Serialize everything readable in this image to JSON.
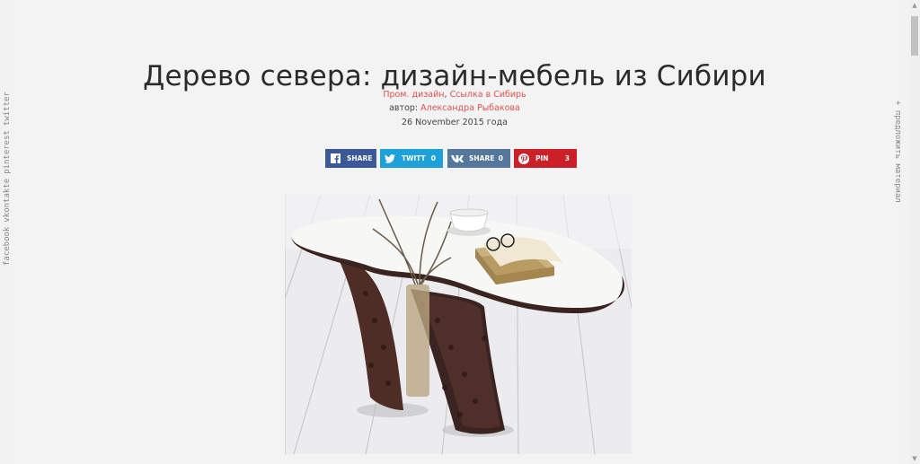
{
  "article": {
    "title": "Дерево севера: дизайн-мебель из Сибири",
    "categories": [
      "Пром. дизайн",
      "Ссылка в Сибирь"
    ],
    "category_separator": ", ",
    "author_prefix": "автор: ",
    "author_name": "Александра Рыбакова",
    "date": "26 November 2015 года"
  },
  "share": {
    "facebook": {
      "label": "SHARE",
      "icon": "facebook-icon"
    },
    "twitter": {
      "label": "TWITT",
      "count": "0",
      "icon": "twitter-icon"
    },
    "vkontakte": {
      "label": "SHARE",
      "count": "0",
      "icon": "vk-icon"
    },
    "pinterest": {
      "label": "PIN",
      "count": "3",
      "icon": "pinterest-icon"
    }
  },
  "side_left": [
    "facebook",
    "vkontakte",
    "pinterest",
    "twitter"
  ],
  "side_right": "+ предложить материал",
  "colors": {
    "accent": "#e05050",
    "facebook": "#3b5998",
    "twitter": "#1da1d9",
    "vkontakte": "#55779b",
    "pinterest": "#cb2027"
  }
}
